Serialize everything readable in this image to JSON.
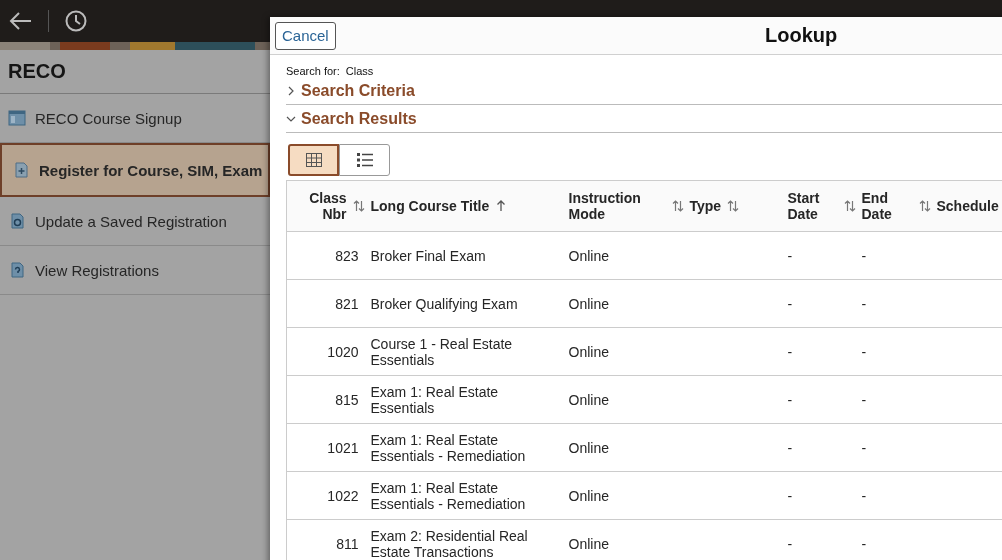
{
  "sidebar": {
    "title": "RECO",
    "items": [
      {
        "label": "RECO Course Signup",
        "selected": false
      },
      {
        "label": "Register for Course, SIM, Exam",
        "selected": true
      },
      {
        "label": "Update a Saved Registration",
        "selected": false
      },
      {
        "label": "View Registrations",
        "selected": false
      }
    ]
  },
  "dialog": {
    "title": "Lookup",
    "cancel": "Cancel",
    "search_for_label": "Search for:",
    "search_for_value": "Class",
    "sections": [
      {
        "label": "Search Criteria",
        "expanded": false
      },
      {
        "label": "Search Results",
        "expanded": true
      }
    ],
    "view_toggle": [
      {
        "kind": "grid",
        "selected": true
      },
      {
        "kind": "list",
        "selected": false
      }
    ],
    "table": {
      "columns": [
        {
          "label": "Class Nbr",
          "sorted": false
        },
        {
          "label": "Long Course Title",
          "sorted": true
        },
        {
          "label": "Instruction Mode",
          "sorted": false
        },
        {
          "label": "Type",
          "sorted": false
        },
        {
          "label": "Start Date",
          "sorted": false
        },
        {
          "label": "End Date",
          "sorted": false
        },
        {
          "label": "Schedule"
        }
      ],
      "rows": [
        [
          "823",
          "Broker Final Exam",
          "Online",
          "",
          "-",
          "-",
          ""
        ],
        [
          "821",
          "Broker Qualifying Exam",
          "Online",
          "",
          "-",
          "-",
          ""
        ],
        [
          "1020",
          "Course 1 - Real Estate Essentials",
          "Online",
          "",
          "-",
          "-",
          ""
        ],
        [
          "815",
          "Exam 1: Real Estate Essentials",
          "Online",
          "",
          "-",
          "-",
          ""
        ],
        [
          "1021",
          "Exam 1: Real Estate Essentials - Remediation",
          "Online",
          "",
          "-",
          "-",
          ""
        ],
        [
          "1022",
          "Exam 1: Real Estate Essentials - Remediation",
          "Online",
          "",
          "-",
          "-",
          ""
        ],
        [
          "811",
          "Exam 2: Residential Real Estate Transactions",
          "Online",
          "",
          "-",
          "-",
          ""
        ]
      ]
    }
  }
}
